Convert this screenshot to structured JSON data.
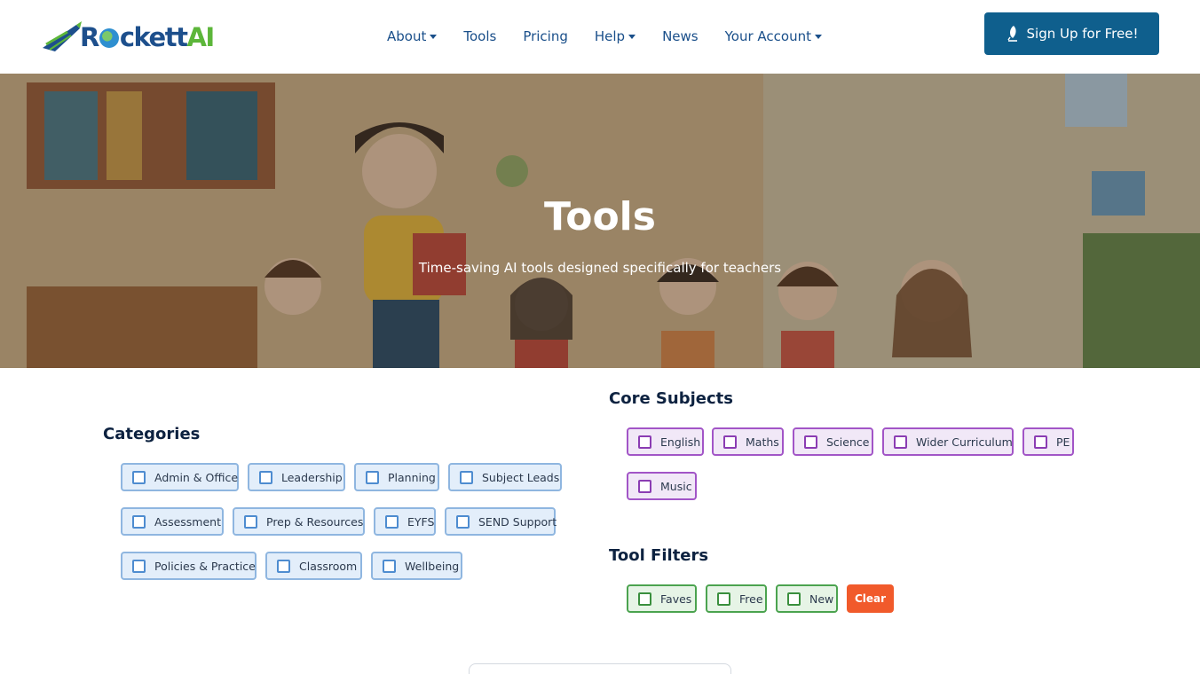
{
  "brand": {
    "name_prefix": "R",
    "name_mid": "ckett",
    "name_suffix": "AI"
  },
  "nav": {
    "items": [
      {
        "label": "About",
        "dropdown": true
      },
      {
        "label": "Tools",
        "dropdown": false
      },
      {
        "label": "Pricing",
        "dropdown": false
      },
      {
        "label": "Help",
        "dropdown": true
      },
      {
        "label": "News",
        "dropdown": false
      },
      {
        "label": "Your Account",
        "dropdown": true
      }
    ],
    "signup_label": "Sign Up for Free!"
  },
  "hero": {
    "title": "Tools",
    "subtitle": "Time-saving AI tools designed specifically for teachers"
  },
  "categories": {
    "heading": "Categories",
    "items": [
      "Admin & Office",
      "Leadership",
      "Planning",
      "Subject Leads",
      "Assessment",
      "Prep & Resources",
      "EYFS",
      "SEND Support",
      "Policies & Practice",
      "Classroom",
      "Wellbeing"
    ]
  },
  "core_subjects": {
    "heading": "Core Subjects",
    "items": [
      "English",
      "Maths",
      "Science",
      "Wider Curriculum",
      "PE",
      "Music"
    ]
  },
  "tool_filters": {
    "heading": "Tool Filters",
    "items": [
      "Faves",
      "Free",
      "New"
    ],
    "clear_label": "Clear"
  },
  "colors": {
    "primary": "#0f5f8d",
    "nav_text": "#1a4f8a",
    "category_border": "#8fb6e0",
    "subject_border": "#a255c7",
    "filter_border": "#4ba34f",
    "clear": "#f15a2b"
  }
}
